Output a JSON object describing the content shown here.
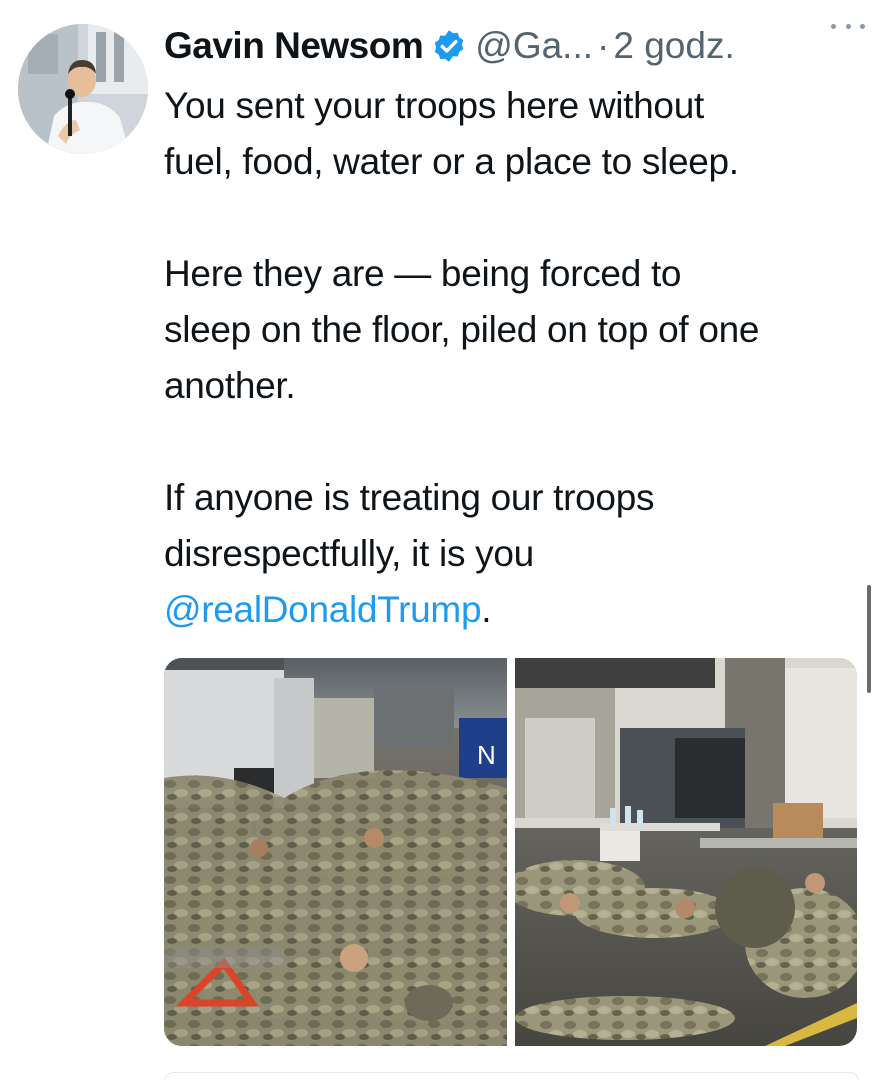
{
  "author": {
    "name": "Gavin Newsom",
    "handle": "@Ga...",
    "separator": "·",
    "time": "2 godz.",
    "verified_icon": "verified-badge-icon",
    "more_icon": "more-dots-icon"
  },
  "tweet": {
    "line1": "You sent your troops here without",
    "line2": "fuel, food, water or a place to sleep.",
    "line3": "Here they are — being forced to",
    "line4": "sleep on the floor, piled on top of one",
    "line5": "another.",
    "line6": "If anyone is treating our troops",
    "line7": "disrespectfully, it is you",
    "mention": "@realDonaldTrump",
    "mention_suffix": "."
  },
  "media": {
    "left_sign": "N"
  },
  "colors": {
    "link": "#1d9bf0",
    "verified": "#1d9bf0",
    "secondary_text": "#536471"
  }
}
